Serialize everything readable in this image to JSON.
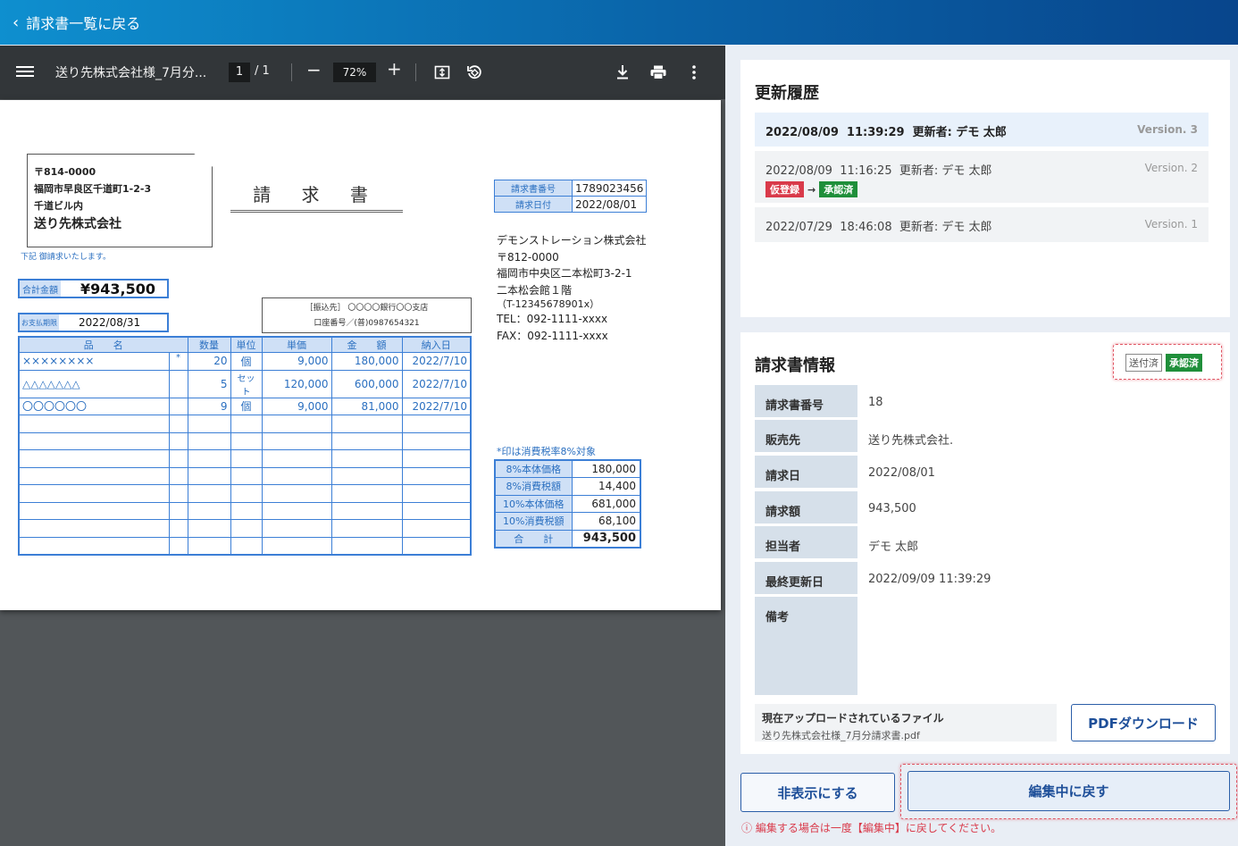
{
  "topbar": {
    "back_label": "請求書一覧に戻る"
  },
  "viewer": {
    "filename": "送り先株式会社様_7月分...",
    "page_current": "1",
    "page_total": "/ 1",
    "zoom": "72%"
  },
  "invoice": {
    "postal": "〒814-0000",
    "address1": "福岡市早良区千道町1-2-3",
    "address2": "千道ビル内",
    "recipient": "送り先株式会社",
    "note": "下記 御請求いたします。",
    "title": "請 求 書",
    "number_label": "請求書番号",
    "number_value": "1789023456",
    "date_label": "請求日付",
    "date_value": "2022/08/01",
    "total_label": "合計金額",
    "total_value": "¥943,500",
    "due_label": "お支払期限",
    "due_value": "2022/08/31",
    "bank_line1": "［振込先］ 〇〇〇〇銀行〇〇支店",
    "bank_line2": "口座番号／(普)0987654321",
    "sender": {
      "company": "デモンストレーション株式会社",
      "postal": "〒812-0000",
      "address1": "福岡市中央区二本松町3-2-1",
      "address2": "二本松会館１階",
      "reg_no": "（T-12345678901x）",
      "tel": "TEL：092-1111-xxxx",
      "fax": "FAX：092-1111-xxxx"
    },
    "columns": [
      "品　　名",
      "数量",
      "単位",
      "単価",
      "金　　額",
      "納入日"
    ],
    "rows": [
      {
        "name": "××××××××",
        "mark": "*",
        "qty": "20",
        "unit": "個",
        "price": "9,000",
        "amount": "180,000",
        "date": "2022/7/10"
      },
      {
        "name": "△△△△△△△",
        "mark": "",
        "qty": "5",
        "unit": "セット",
        "price": "120,000",
        "amount": "600,000",
        "date": "2022/7/10"
      },
      {
        "name": "〇〇〇〇〇〇",
        "mark": "",
        "qty": "9",
        "unit": "個",
        "price": "9,000",
        "amount": "81,000",
        "date": "2022/7/10"
      }
    ],
    "tax_note": "*印は消費税率8%対象",
    "summary": [
      {
        "label": "8%本体価格",
        "value": "180,000"
      },
      {
        "label": "8%消費税額",
        "value": "14,400"
      },
      {
        "label": "10%本体価格",
        "value": "681,000"
      },
      {
        "label": "10%消費税額",
        "value": "68,100"
      },
      {
        "label": "合　　計",
        "value": "943,500"
      }
    ]
  },
  "history": {
    "title": "更新履歴",
    "items": [
      {
        "date": "2022/08/09",
        "time": "11:39:29",
        "editor": "更新者: デモ 太郎",
        "version": "Version. 3"
      },
      {
        "date": "2022/08/09",
        "time": "11:16:25",
        "editor": "更新者: デモ 太郎",
        "version": "Version. 2",
        "from": "仮登録",
        "arrow": "→",
        "to": "承認済"
      },
      {
        "date": "2022/07/29",
        "time": "18:46:08",
        "editor": "更新者: デモ 太郎",
        "version": "Version. 1"
      }
    ]
  },
  "info": {
    "title": "請求書情報",
    "badge_sent": "送付済",
    "badge_approved": "承認済",
    "rows": [
      {
        "key": "請求書番号",
        "value": "18"
      },
      {
        "key": "販売先",
        "value": "送り先株式会社."
      },
      {
        "key": "請求日",
        "value": "2022/08/01"
      },
      {
        "key": "請求額",
        "value": "943,500"
      },
      {
        "key": "担当者",
        "value": "デモ 太郎"
      },
      {
        "key": "最終更新日",
        "value": "2022/09/09 11:39:29"
      },
      {
        "key": "備考",
        "value": ""
      }
    ],
    "file_label": "現在アップロードされているファイル",
    "file_name": "送り先株式会社様_7月分請求書.pdf",
    "pdf_button": "PDFダウンロード"
  },
  "actions": {
    "hide_button": "非表示にする",
    "revert_button": "編集中に戻す",
    "warning": "ⓘ 編集する場合は一度【編集中】に戻してください。"
  },
  "colors": {
    "accent": "#1e4f99",
    "approved": "#1f8f3a",
    "provisional": "#d93a4a",
    "highlight": "#e05462"
  }
}
